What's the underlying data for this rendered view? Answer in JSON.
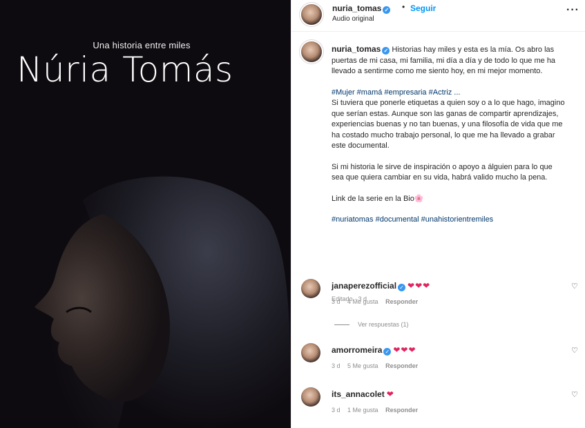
{
  "media": {
    "tagline": "Una historia entre miles",
    "title": "Núria Tomás"
  },
  "header": {
    "username": "nuria_tomas",
    "separator": "•",
    "follow_label": "Seguir",
    "audio_label": "Audio original",
    "more_icon": "more-horizontal-icon"
  },
  "caption": {
    "username": "nuria_tomas",
    "intro": "Historias hay miles y esta es la mía. Os abro las puertas de mi casa, mi familia, mi día a día y de todo lo que me ha llevado a sentirme como me siento hoy, en mi mejor momento.",
    "hashtags_1": "#Mujer #mamá #empresaria #Actriz ...",
    "paragraph_2": "Si tuviera que ponerle etiquetas a quien soy o a lo que hago, imagino que serían estas. Aunque son las ganas de compartir aprendizajes, experiencias buenas y no tan buenas, y una filosofía de vida que me ha costado mucho trabajo personal, lo que me ha llevado a grabar este documental.",
    "paragraph_3": "Si mi historia le sirve de inspiración o apoyo a álguien para lo que sea que quiera cambiar en su vida, habrá valido mucho la pena.",
    "paragraph_4": "Link de la serie en la Bio🌸",
    "hashtags_2": "#nuriatomas #documental #unahistorientremiles",
    "edited": "Editado · 3 d"
  },
  "comments": [
    {
      "username": "janaperezofficial",
      "text": "❤❤❤",
      "time": "3 d",
      "likes": "4 Me gusta",
      "reply": "Responder",
      "view_replies": "Ver respuestas (1)"
    },
    {
      "username": "amorromeira",
      "text": "❤❤❤",
      "time": "3 d",
      "likes": "5 Me gusta",
      "reply": "Responder"
    },
    {
      "username": "its_annacolet",
      "text": "❤",
      "time": "3 d",
      "likes": "1 Me gusta",
      "reply": "Responder"
    }
  ],
  "colors": {
    "accent": "#0095f6",
    "verified": "#3897f0",
    "heart": "#e0245e",
    "hashtag": "#00376b"
  }
}
